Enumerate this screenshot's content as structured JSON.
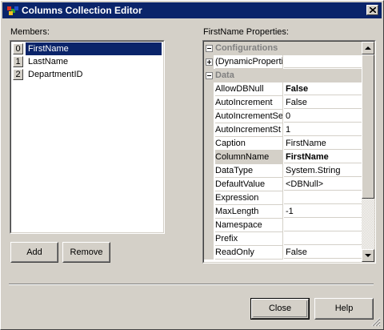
{
  "window": {
    "title": "Columns Collection Editor",
    "titlebar_color": "#0a246a",
    "face_color": "#d4d0c8"
  },
  "members": {
    "label": "Members:",
    "items": [
      {
        "index": "0",
        "name": "FirstName",
        "selected": true
      },
      {
        "index": "1",
        "name": "LastName",
        "selected": false
      },
      {
        "index": "2",
        "name": "DepartmentID",
        "selected": false
      }
    ],
    "add_label": "Add",
    "remove_label": "Remove"
  },
  "properties": {
    "label": "FirstName Properties:",
    "categories": {
      "configurations": "Configurations",
      "dynamic": "(DynamicProperti",
      "data": "Data"
    },
    "rows": [
      {
        "name": "AllowDBNull",
        "value": "False",
        "bold": true
      },
      {
        "name": "AutoIncrement",
        "value": "False",
        "bold": false
      },
      {
        "name": "AutoIncrementSe",
        "value": "0",
        "bold": false
      },
      {
        "name": "AutoIncrementSt",
        "value": "1",
        "bold": false
      },
      {
        "name": "Caption",
        "value": "FirstName",
        "bold": false
      },
      {
        "name": "ColumnName",
        "value": "FirstName",
        "bold": true
      },
      {
        "name": "DataType",
        "value": "System.String",
        "bold": false
      },
      {
        "name": "DefaultValue",
        "value": "<DBNull>",
        "bold": false
      },
      {
        "name": "Expression",
        "value": "",
        "bold": false
      },
      {
        "name": "MaxLength",
        "value": "-1",
        "bold": false
      },
      {
        "name": "Namespace",
        "value": "",
        "bold": false
      },
      {
        "name": "Prefix",
        "value": "",
        "bold": false
      },
      {
        "name": "ReadOnly",
        "value": "False",
        "bold": false
      }
    ]
  },
  "footer": {
    "close_label": "Close",
    "help_label": "Help"
  },
  "icons": {
    "app": "app-icon",
    "close": "close-icon",
    "scroll_up": "scroll-up-icon",
    "scroll_down": "scroll-down-icon",
    "resize": "resize-grip-icon"
  }
}
